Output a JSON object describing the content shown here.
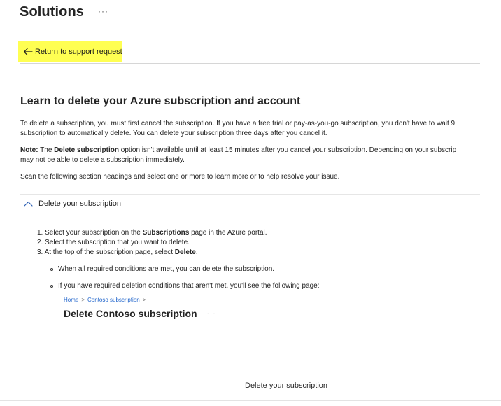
{
  "header": {
    "title": "Solutions",
    "more_label": "···"
  },
  "back_link": {
    "label": "Return to support request",
    "icon": "arrow-left-icon"
  },
  "article": {
    "title": "Learn to delete your Azure subscription and account",
    "para1": {
      "line1": "To delete a subscription, you must first cancel the subscription. If you have a free trial or pay-as-you-go subscription, you don't have to wait 9",
      "line2": "subscription to automatically delete. You can delete your subscription three days after you cancel it."
    },
    "note": {
      "label": "Note:",
      "text_a": " The ",
      "bold_term": "Delete subscription",
      "text_b": " option isn't available until at least 15 minutes after you cancel your subscription. Depending on your subscrip",
      "line2": "may not be able to delete a subscription immediately."
    },
    "para3": "Scan the following section headings and select one or more to learn more or to help resolve your issue."
  },
  "accordion": {
    "label": "Delete your subscription",
    "icon": "chevron-up-icon",
    "steps": [
      {
        "prefix": "1. Select your subscription on the ",
        "bold": "Subscriptions",
        "suffix": " page in the Azure portal."
      },
      {
        "prefix": "2. Select the subscription that you want to delete.",
        "bold": "",
        "suffix": ""
      },
      {
        "prefix": "3. At the top of the subscription page, select ",
        "bold": "Delete",
        "suffix": "."
      }
    ],
    "bullets": [
      "When all required conditions are met, you can delete the subscription.",
      "If you have required deletion conditions that aren't met, you'll see the following page:"
    ]
  },
  "embedded_screenshot": {
    "breadcrumb": [
      "Home",
      "Contoso subscription"
    ],
    "breadcrumb_sep": ">",
    "title": "Delete Contoso subscription",
    "more_label": "···",
    "caption": "Delete your subscription"
  },
  "colors": {
    "highlight": "#ffff52",
    "link": "#2266cc",
    "text": "#242424"
  }
}
